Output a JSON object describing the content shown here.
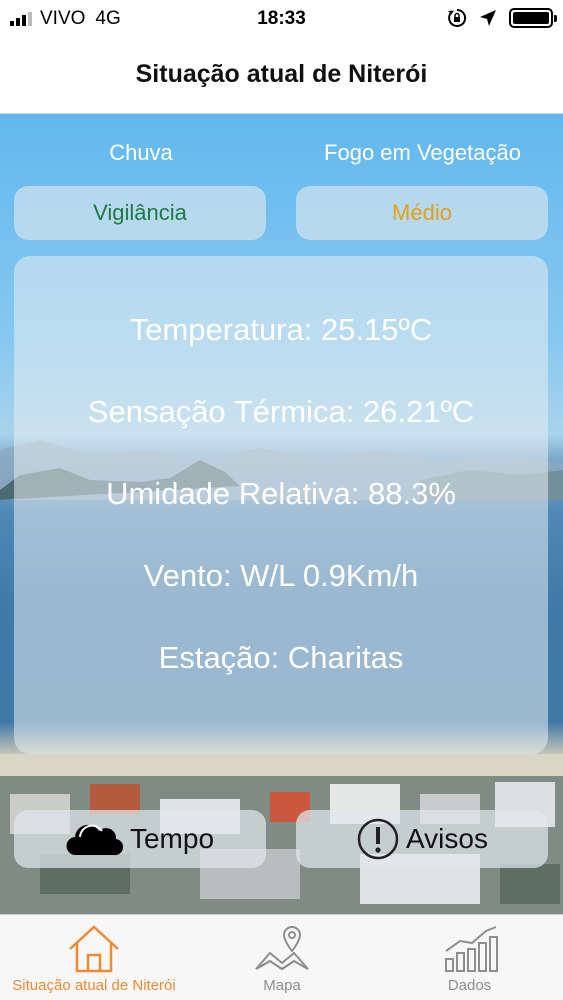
{
  "status_bar": {
    "carrier": "VIVO",
    "network": "4G",
    "time": "18:33"
  },
  "nav": {
    "title": "Situação atual de Niterói"
  },
  "alerts": {
    "rain": {
      "label": "Chuva",
      "status": "Vigilância",
      "color": "#1f7a41"
    },
    "fire": {
      "label": "Fogo em Vegetação",
      "status": "Médio",
      "color": "#e3a01a"
    }
  },
  "weather": {
    "temperature": "Temperatura: 25.15ºC",
    "feels_like": "Sensação Térmica: 26.21ºC",
    "humidity": "Umidade Relativa: 88.3%",
    "wind": "Vento: W/L 0.9Km/h",
    "station": "Estação: Charitas"
  },
  "actions": {
    "tempo_label": "Tempo",
    "avisos_label": "Avisos"
  },
  "tabs": [
    {
      "label": "Situação atual de Niterói",
      "icon": "home-icon",
      "active": true
    },
    {
      "label": "Mapa",
      "icon": "map-icon",
      "active": false
    },
    {
      "label": "Dados",
      "icon": "chart-icon",
      "active": false
    }
  ],
  "colors": {
    "accent": "#ef8a34",
    "inactive_tab": "#8e8e8e"
  }
}
